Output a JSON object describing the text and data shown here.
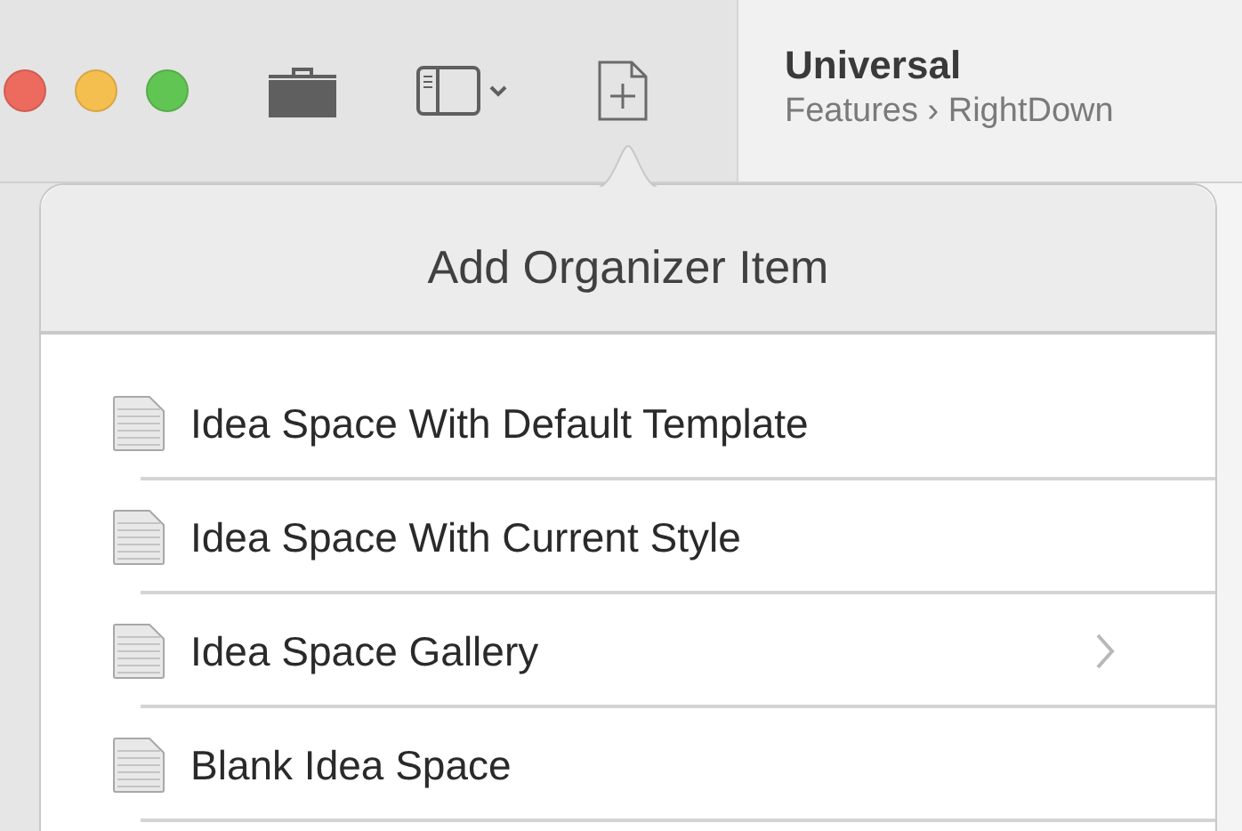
{
  "window": {
    "title": "Universal",
    "breadcrumb": "Features › RightDown"
  },
  "popover": {
    "title": "Add Organizer Item",
    "items": [
      {
        "label": "Idea Space With Default Template",
        "has_submenu": false
      },
      {
        "label": "Idea Space With Current Style",
        "has_submenu": false
      },
      {
        "label": "Idea Space Gallery",
        "has_submenu": true
      },
      {
        "label": "Blank Idea Space",
        "has_submenu": false
      }
    ]
  }
}
